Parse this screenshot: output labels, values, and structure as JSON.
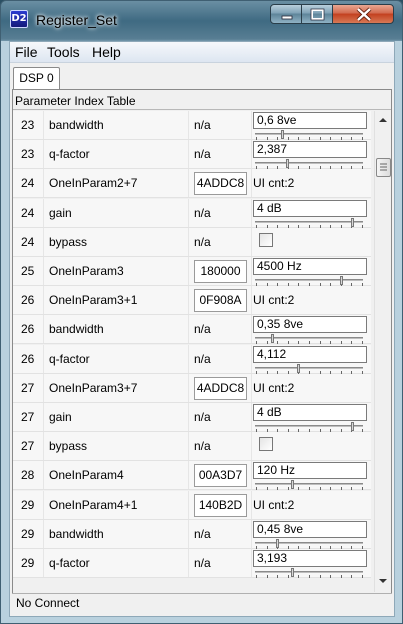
{
  "window": {
    "title": "Register_Set",
    "icon_label": "D2"
  },
  "menu": [
    "File",
    "Tools",
    "Help"
  ],
  "tabs": [
    "DSP 0"
  ],
  "table_header": "Parameter Index Table",
  "rows": [
    {
      "idx": "23",
      "name": "bandwidth",
      "val": "n/a",
      "ctrl": "slider",
      "text": "0,6 8ve",
      "level": 0.25
    },
    {
      "idx": "23",
      "name": "q-factor",
      "val": "n/a",
      "ctrl": "slider",
      "text": "2,387",
      "level": 0.3
    },
    {
      "idx": "24",
      "name": "OneInParam2+7",
      "hex": "4ADDC8",
      "ui": "UI cnt:2"
    },
    {
      "idx": "24",
      "name": "gain",
      "val": "n/a",
      "ctrl": "slider",
      "text": "4 dB",
      "level": 0.92
    },
    {
      "idx": "24",
      "name": "bypass",
      "val": "n/a",
      "ctrl": "check"
    },
    {
      "idx": "25",
      "name": "OneInParam3",
      "hex": "180000",
      "ctrl": "slider",
      "text": "4500 Hz",
      "level": 0.82
    },
    {
      "idx": "26",
      "name": "OneInParam3+1",
      "hex": "0F908A",
      "ui": "UI cnt:2"
    },
    {
      "idx": "26",
      "name": "bandwidth",
      "val": "n/a",
      "ctrl": "slider",
      "text": "0,35 8ve",
      "level": 0.15
    },
    {
      "idx": "26",
      "name": "q-factor",
      "val": "n/a",
      "ctrl": "slider",
      "text": "4,112",
      "level": 0.4
    },
    {
      "idx": "27",
      "name": "OneInParam3+7",
      "hex": "4ADDC8",
      "ui": "UI cnt:2"
    },
    {
      "idx": "27",
      "name": "gain",
      "val": "n/a",
      "ctrl": "slider",
      "text": "4 dB",
      "level": 0.92
    },
    {
      "idx": "27",
      "name": "bypass",
      "val": "n/a",
      "ctrl": "check"
    },
    {
      "idx": "28",
      "name": "OneInParam4",
      "hex": "00A3D7",
      "ctrl": "slider",
      "text": "120 Hz",
      "level": 0.35
    },
    {
      "idx": "29",
      "name": "OneInParam4+1",
      "hex": "140B2D",
      "ui": "UI cnt:2"
    },
    {
      "idx": "29",
      "name": "bandwidth",
      "val": "n/a",
      "ctrl": "slider",
      "text": "0,45 8ve",
      "level": 0.2
    },
    {
      "idx": "29",
      "name": "q-factor",
      "val": "n/a",
      "ctrl": "slider",
      "text": "3,193",
      "level": 0.35
    }
  ],
  "status": "No Connect",
  "icons": {
    "minimize": "minimize-icon",
    "maximize": "maximize-icon",
    "close": "close-icon",
    "scroll_up": "scroll-up-icon",
    "scroll_down": "scroll-down-icon"
  }
}
